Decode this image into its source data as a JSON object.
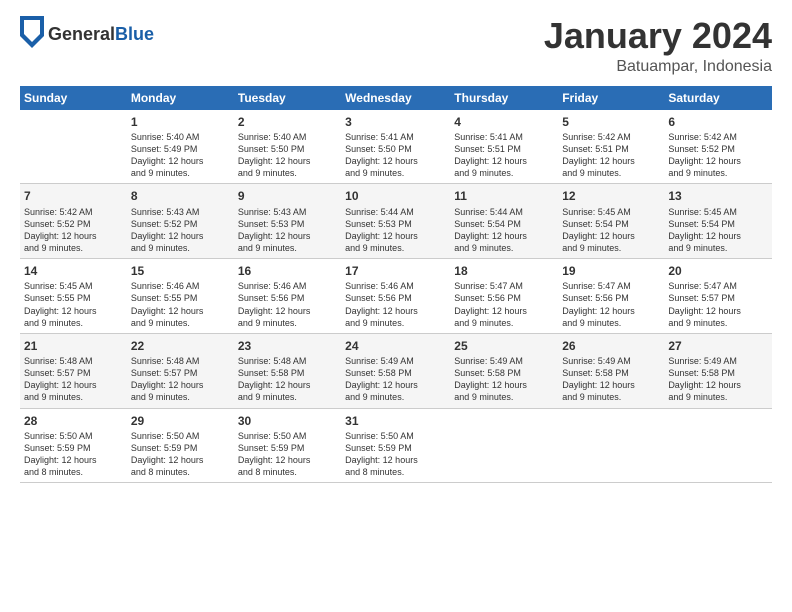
{
  "header": {
    "logo_line1": "General",
    "logo_line2": "Blue",
    "title": "January 2024",
    "subtitle": "Batuampar, Indonesia"
  },
  "weekdays": [
    "Sunday",
    "Monday",
    "Tuesday",
    "Wednesday",
    "Thursday",
    "Friday",
    "Saturday"
  ],
  "weeks": [
    [
      {
        "day": "",
        "info": ""
      },
      {
        "day": "1",
        "info": "Sunrise: 5:40 AM\nSunset: 5:49 PM\nDaylight: 12 hours\nand 9 minutes."
      },
      {
        "day": "2",
        "info": "Sunrise: 5:40 AM\nSunset: 5:50 PM\nDaylight: 12 hours\nand 9 minutes."
      },
      {
        "day": "3",
        "info": "Sunrise: 5:41 AM\nSunset: 5:50 PM\nDaylight: 12 hours\nand 9 minutes."
      },
      {
        "day": "4",
        "info": "Sunrise: 5:41 AM\nSunset: 5:51 PM\nDaylight: 12 hours\nand 9 minutes."
      },
      {
        "day": "5",
        "info": "Sunrise: 5:42 AM\nSunset: 5:51 PM\nDaylight: 12 hours\nand 9 minutes."
      },
      {
        "day": "6",
        "info": "Sunrise: 5:42 AM\nSunset: 5:52 PM\nDaylight: 12 hours\nand 9 minutes."
      }
    ],
    [
      {
        "day": "7",
        "info": "Sunrise: 5:42 AM\nSunset: 5:52 PM\nDaylight: 12 hours\nand 9 minutes."
      },
      {
        "day": "8",
        "info": "Sunrise: 5:43 AM\nSunset: 5:52 PM\nDaylight: 12 hours\nand 9 minutes."
      },
      {
        "day": "9",
        "info": "Sunrise: 5:43 AM\nSunset: 5:53 PM\nDaylight: 12 hours\nand 9 minutes."
      },
      {
        "day": "10",
        "info": "Sunrise: 5:44 AM\nSunset: 5:53 PM\nDaylight: 12 hours\nand 9 minutes."
      },
      {
        "day": "11",
        "info": "Sunrise: 5:44 AM\nSunset: 5:54 PM\nDaylight: 12 hours\nand 9 minutes."
      },
      {
        "day": "12",
        "info": "Sunrise: 5:45 AM\nSunset: 5:54 PM\nDaylight: 12 hours\nand 9 minutes."
      },
      {
        "day": "13",
        "info": "Sunrise: 5:45 AM\nSunset: 5:54 PM\nDaylight: 12 hours\nand 9 minutes."
      }
    ],
    [
      {
        "day": "14",
        "info": "Sunrise: 5:45 AM\nSunset: 5:55 PM\nDaylight: 12 hours\nand 9 minutes."
      },
      {
        "day": "15",
        "info": "Sunrise: 5:46 AM\nSunset: 5:55 PM\nDaylight: 12 hours\nand 9 minutes."
      },
      {
        "day": "16",
        "info": "Sunrise: 5:46 AM\nSunset: 5:56 PM\nDaylight: 12 hours\nand 9 minutes."
      },
      {
        "day": "17",
        "info": "Sunrise: 5:46 AM\nSunset: 5:56 PM\nDaylight: 12 hours\nand 9 minutes."
      },
      {
        "day": "18",
        "info": "Sunrise: 5:47 AM\nSunset: 5:56 PM\nDaylight: 12 hours\nand 9 minutes."
      },
      {
        "day": "19",
        "info": "Sunrise: 5:47 AM\nSunset: 5:56 PM\nDaylight: 12 hours\nand 9 minutes."
      },
      {
        "day": "20",
        "info": "Sunrise: 5:47 AM\nSunset: 5:57 PM\nDaylight: 12 hours\nand 9 minutes."
      }
    ],
    [
      {
        "day": "21",
        "info": "Sunrise: 5:48 AM\nSunset: 5:57 PM\nDaylight: 12 hours\nand 9 minutes."
      },
      {
        "day": "22",
        "info": "Sunrise: 5:48 AM\nSunset: 5:57 PM\nDaylight: 12 hours\nand 9 minutes."
      },
      {
        "day": "23",
        "info": "Sunrise: 5:48 AM\nSunset: 5:58 PM\nDaylight: 12 hours\nand 9 minutes."
      },
      {
        "day": "24",
        "info": "Sunrise: 5:49 AM\nSunset: 5:58 PM\nDaylight: 12 hours\nand 9 minutes."
      },
      {
        "day": "25",
        "info": "Sunrise: 5:49 AM\nSunset: 5:58 PM\nDaylight: 12 hours\nand 9 minutes."
      },
      {
        "day": "26",
        "info": "Sunrise: 5:49 AM\nSunset: 5:58 PM\nDaylight: 12 hours\nand 9 minutes."
      },
      {
        "day": "27",
        "info": "Sunrise: 5:49 AM\nSunset: 5:58 PM\nDaylight: 12 hours\nand 9 minutes."
      }
    ],
    [
      {
        "day": "28",
        "info": "Sunrise: 5:50 AM\nSunset: 5:59 PM\nDaylight: 12 hours\nand 8 minutes."
      },
      {
        "day": "29",
        "info": "Sunrise: 5:50 AM\nSunset: 5:59 PM\nDaylight: 12 hours\nand 8 minutes."
      },
      {
        "day": "30",
        "info": "Sunrise: 5:50 AM\nSunset: 5:59 PM\nDaylight: 12 hours\nand 8 minutes."
      },
      {
        "day": "31",
        "info": "Sunrise: 5:50 AM\nSunset: 5:59 PM\nDaylight: 12 hours\nand 8 minutes."
      },
      {
        "day": "",
        "info": ""
      },
      {
        "day": "",
        "info": ""
      },
      {
        "day": "",
        "info": ""
      }
    ]
  ]
}
